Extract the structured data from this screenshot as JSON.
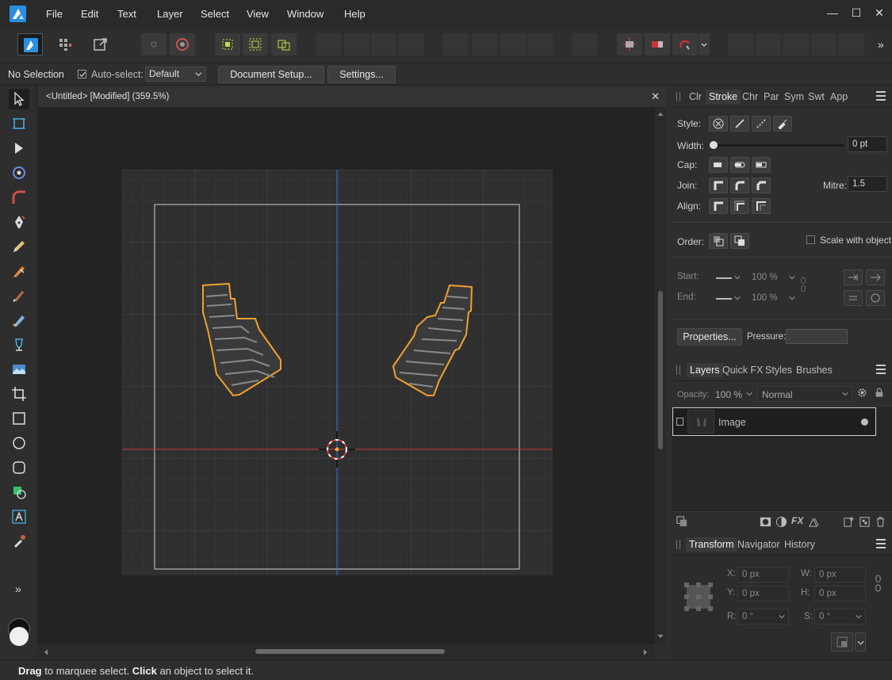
{
  "menu": {
    "items": [
      "File",
      "Edit",
      "Text",
      "Layer",
      "Select",
      "View",
      "Window",
      "Help"
    ]
  },
  "window_controls": {
    "minimize": "—",
    "maximize": "☐",
    "close": "✕"
  },
  "toolbar": {
    "more": "»"
  },
  "context": {
    "selection": "No Selection",
    "auto_select_label": "Auto-select:",
    "auto_select_value": "Default",
    "document_setup": "Document Setup...",
    "settings": "Settings..."
  },
  "document": {
    "title": "<Untitled> [Modified] (359.5%)",
    "close": "✕"
  },
  "tools": {
    "more": "»"
  },
  "status": {
    "drag": "Drag",
    "drag_text": " to marquee select. ",
    "click": "Click",
    "click_text": " an object to select it."
  },
  "stroke_panel": {
    "tabs": [
      "Clr",
      "Stroke",
      "Chr",
      "Par",
      "Sym",
      "Swt",
      "App"
    ],
    "active_tab": "Stroke",
    "style_label": "Style:",
    "width_label": "Width:",
    "width_value": "0 pt",
    "cap_label": "Cap:",
    "join_label": "Join:",
    "mitre_label": "Mitre:",
    "mitre_value": "1.5",
    "align_label": "Align:",
    "order_label": "Order:",
    "scale_label": "Scale with object",
    "start_label": "Start:",
    "end_label": "End:",
    "start_pct": "100 %",
    "end_pct": "100 %",
    "properties": "Properties...",
    "pressure_label": "Pressure:"
  },
  "layers_panel": {
    "tabs": [
      "Layers",
      "Quick FX",
      "Styles",
      "Brushes"
    ],
    "active_tab": "Layers",
    "opacity_label": "Opacity:",
    "opacity_value": "100 %",
    "blend_mode": "Normal",
    "layers": [
      {
        "name": "Image"
      }
    ]
  },
  "transform_panel": {
    "tabs": [
      "Transform",
      "Navigator",
      "History"
    ],
    "active_tab": "Transform",
    "x_label": "X:",
    "x_value": "0 px",
    "y_label": "Y:",
    "y_value": "0 px",
    "w_label": "W:",
    "w_value": "0 px",
    "h_label": "H:",
    "h_value": "0 px",
    "r_label": "R:",
    "r_value": "0 °",
    "s_label": "S:",
    "s_value": "0 °"
  },
  "colors": {
    "accent": "#2a8fe0",
    "selection_outline": "#f0a030",
    "guide_vertical": "#3a6fd8",
    "guide_horizontal": "#c83a3a"
  }
}
